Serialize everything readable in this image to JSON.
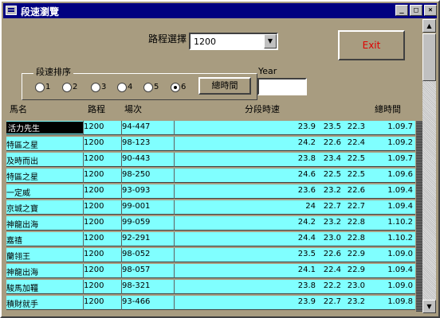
{
  "window": {
    "title": "段速瀏覽",
    "minimize": "_",
    "maximize": "□",
    "close": "×"
  },
  "controls": {
    "route_label": "路程選擇",
    "route_value": "1200",
    "exit_label": "Exit",
    "year_label": "Year",
    "year_value": "",
    "sort_title": "段速排序",
    "sort_options": [
      "1",
      "2",
      "3",
      "4",
      "5",
      "6"
    ],
    "sort_selected": "6",
    "total_time_label": "總時間"
  },
  "columns": {
    "name": "馬名",
    "route": "路程",
    "session": "場次",
    "split": "分段時速",
    "total": "總時間"
  },
  "rows": [
    {
      "name": "活力先生",
      "route": "1200",
      "session": "94-447",
      "s1": "23.9",
      "s2": "23.5",
      "s3": "22.3",
      "total": "1.09.7"
    },
    {
      "name": "特區之星",
      "route": "1200",
      "session": "98-123",
      "s1": "24.2",
      "s2": "22.6",
      "s3": "22.4",
      "total": "1.09.2"
    },
    {
      "name": "及時而出",
      "route": "1200",
      "session": "90-443",
      "s1": "23.8",
      "s2": "23.4",
      "s3": "22.5",
      "total": "1.09.7"
    },
    {
      "name": "特區之星",
      "route": "1200",
      "session": "98-250",
      "s1": "24.6",
      "s2": "22.5",
      "s3": "22.5",
      "total": "1.09.6"
    },
    {
      "name": "一定威",
      "route": "1200",
      "session": "93-093",
      "s1": "23.6",
      "s2": "23.2",
      "s3": "22.6",
      "total": "1.09.4"
    },
    {
      "name": "京城之寶",
      "route": "1200",
      "session": "99-001",
      "s1": "24",
      "s2": "22.7",
      "s3": "22.7",
      "total": "1.09.4"
    },
    {
      "name": "神龍出海",
      "route": "1200",
      "session": "99-059",
      "s1": "24.2",
      "s2": "23.2",
      "s3": "22.8",
      "total": "1.10.2"
    },
    {
      "name": "嘉禧",
      "route": "1200",
      "session": "92-291",
      "s1": "24.4",
      "s2": "23.0",
      "s3": "22.8",
      "total": "1.10.2"
    },
    {
      "name": "蘭翎王",
      "route": "1200",
      "session": "98-052",
      "s1": "23.5",
      "s2": "22.6",
      "s3": "22.9",
      "total": "1.09.0"
    },
    {
      "name": "神龍出海",
      "route": "1200",
      "session": "98-057",
      "s1": "24.1",
      "s2": "22.4",
      "s3": "22.9",
      "total": "1.09.4"
    },
    {
      "name": "駿馬加韁",
      "route": "1200",
      "session": "98-321",
      "s1": "23.8",
      "s2": "22.2",
      "s3": "23.0",
      "total": "1.09.0"
    },
    {
      "name": "積財就手",
      "route": "1200",
      "session": "93-466",
      "s1": "23.9",
      "s2": "22.7",
      "s3": "23.2",
      "total": "1.09.8"
    }
  ],
  "colors": {
    "row_bg": "#80ffff",
    "window_bg": "#a89c80",
    "titlebar": "#000080",
    "exit_text": "#e00000"
  }
}
